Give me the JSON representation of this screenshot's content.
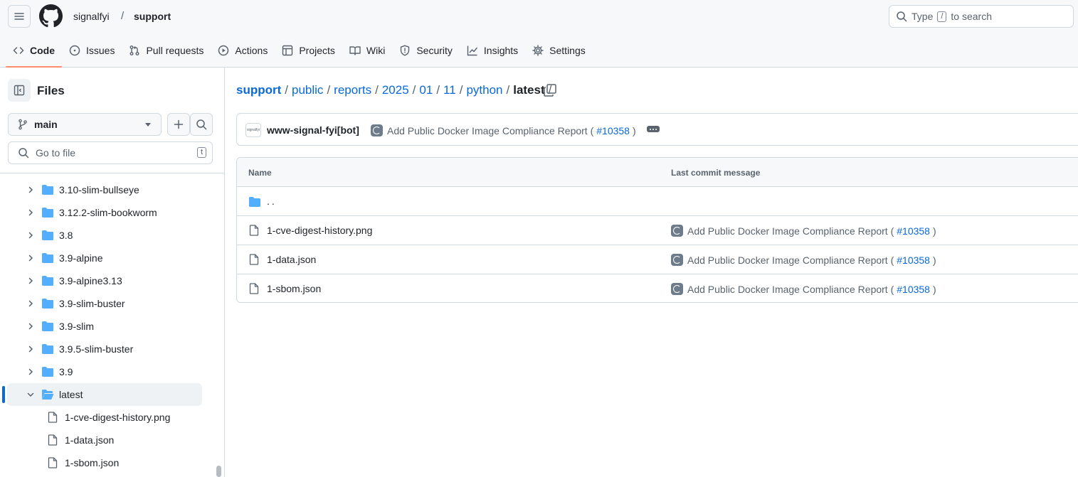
{
  "header": {
    "owner": "signalfyi",
    "separator": "/",
    "repo": "support",
    "search_prefix": "Type",
    "search_key": "/",
    "search_suffix": "to search"
  },
  "tabs": [
    {
      "label": "Code",
      "icon": "code-icon",
      "active": true
    },
    {
      "label": "Issues",
      "icon": "issue-icon"
    },
    {
      "label": "Pull requests",
      "icon": "pull-request-icon"
    },
    {
      "label": "Actions",
      "icon": "play-icon"
    },
    {
      "label": "Projects",
      "icon": "table-icon"
    },
    {
      "label": "Wiki",
      "icon": "book-icon"
    },
    {
      "label": "Security",
      "icon": "shield-icon"
    },
    {
      "label": "Insights",
      "icon": "graph-icon"
    },
    {
      "label": "Settings",
      "icon": "gear-icon"
    }
  ],
  "sidebar": {
    "title": "Files",
    "branch": "main",
    "goto_placeholder": "Go to file",
    "goto_key": "t",
    "tree": [
      {
        "label": "3.10-slim-bullseye",
        "type": "folder"
      },
      {
        "label": "3.12.2-slim-bookworm",
        "type": "folder"
      },
      {
        "label": "3.8",
        "type": "folder"
      },
      {
        "label": "3.9-alpine",
        "type": "folder"
      },
      {
        "label": "3.9-alpine3.13",
        "type": "folder"
      },
      {
        "label": "3.9-slim-buster",
        "type": "folder"
      },
      {
        "label": "3.9-slim",
        "type": "folder"
      },
      {
        "label": "3.9.5-slim-buster",
        "type": "folder"
      },
      {
        "label": "3.9",
        "type": "folder"
      },
      {
        "label": "latest",
        "type": "folder-open",
        "selected": true
      },
      {
        "label": "1-cve-digest-history.png",
        "type": "file"
      },
      {
        "label": "1-data.json",
        "type": "file"
      },
      {
        "label": "1-sbom.json",
        "type": "file"
      }
    ]
  },
  "breadcrumb": {
    "parts": [
      "support",
      "public",
      "reports",
      "2025",
      "01",
      "11",
      "python"
    ],
    "current": "latest",
    "separator": "/"
  },
  "commit": {
    "avatar_text": "signalfyi",
    "author": "www-signal-fyi[bot]",
    "message": "Add Public Docker Image Compliance Report (",
    "pr": "#10358",
    "close_paren": ")"
  },
  "table": {
    "col_name": "Name",
    "col_message": "Last commit message",
    "parent_dir": "..",
    "rows": [
      {
        "name": "1-cve-digest-history.png",
        "message": "Add Public Docker Image Compliance Report (",
        "pr": "#10358",
        "close": ")"
      },
      {
        "name": "1-data.json",
        "message": "Add Public Docker Image Compliance Report (",
        "pr": "#10358",
        "close": ")"
      },
      {
        "name": "1-sbom.json",
        "message": "Add Public Docker Image Compliance Report (",
        "pr": "#10358",
        "close": ")"
      }
    ]
  },
  "colors": {
    "accent_link": "#0969da",
    "active_tab_underline": "#fd8c73",
    "folder": "#54aeff"
  }
}
